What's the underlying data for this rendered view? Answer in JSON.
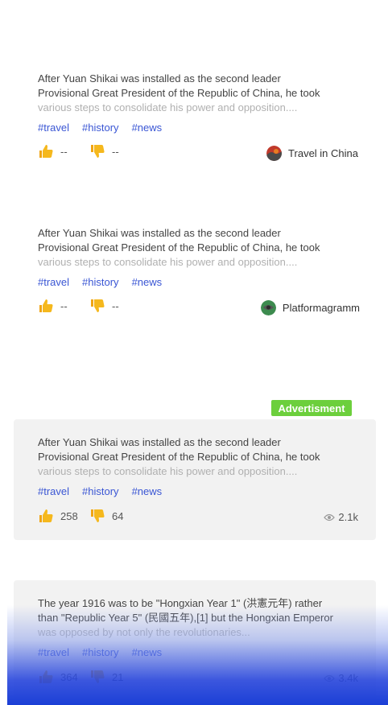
{
  "feed": {
    "cards": [
      {
        "excerpt_line1": "After Yuan Shikai was installed as the second leader",
        "excerpt_line2": "Provisional Great President of the Republic of China, he took",
        "excerpt_line3": "various steps to consolidate his power and opposition....",
        "tags": [
          "#travel",
          "#history",
          "#news"
        ],
        "likes": "--",
        "dislikes": "--",
        "source": "Travel in China"
      },
      {
        "excerpt_line1": "After Yuan Shikai was installed as the second leader",
        "excerpt_line2": "Provisional Great President of the Republic of China, he took",
        "excerpt_line3": "various steps to consolidate his power and opposition....",
        "tags": [
          "#travel",
          "#history",
          "#news"
        ],
        "likes": "--",
        "dislikes": "--",
        "source": "Platformagramm"
      },
      {
        "ad_label": "Advertisment",
        "excerpt_line1": "After Yuan Shikai was installed as the second leader",
        "excerpt_line2": "Provisional Great President of the Republic of China, he took",
        "excerpt_line3": "various steps to consolidate his power and opposition....",
        "tags": [
          "#travel",
          "#history",
          "#news"
        ],
        "likes": "258",
        "dislikes": "64",
        "views": "2.1k"
      },
      {
        "excerpt_line1": "The year 1916 was to be \"Hongxian Year 1\" (洪憲元年) rather",
        "excerpt_line2": "than \"Republic Year 5\" (民國五年),[1] but the Hongxian Emperor",
        "excerpt_line3": "was opposed by not only the revolutionaries...",
        "tags": [
          "#travel",
          "#history",
          "#news"
        ],
        "likes": "364",
        "dislikes": "21",
        "views": "3.4k"
      }
    ]
  },
  "colors": {
    "tag": "#3a56d4",
    "thumb": "#f5b81d",
    "ad_badge": "#6ccf3c",
    "card_background": "#f2f2f2",
    "bottom_overlay": "#1b3fd6"
  },
  "icons": [
    "thumbs-up-icon",
    "thumbs-down-icon",
    "eye-icon",
    "source-avatar"
  ]
}
